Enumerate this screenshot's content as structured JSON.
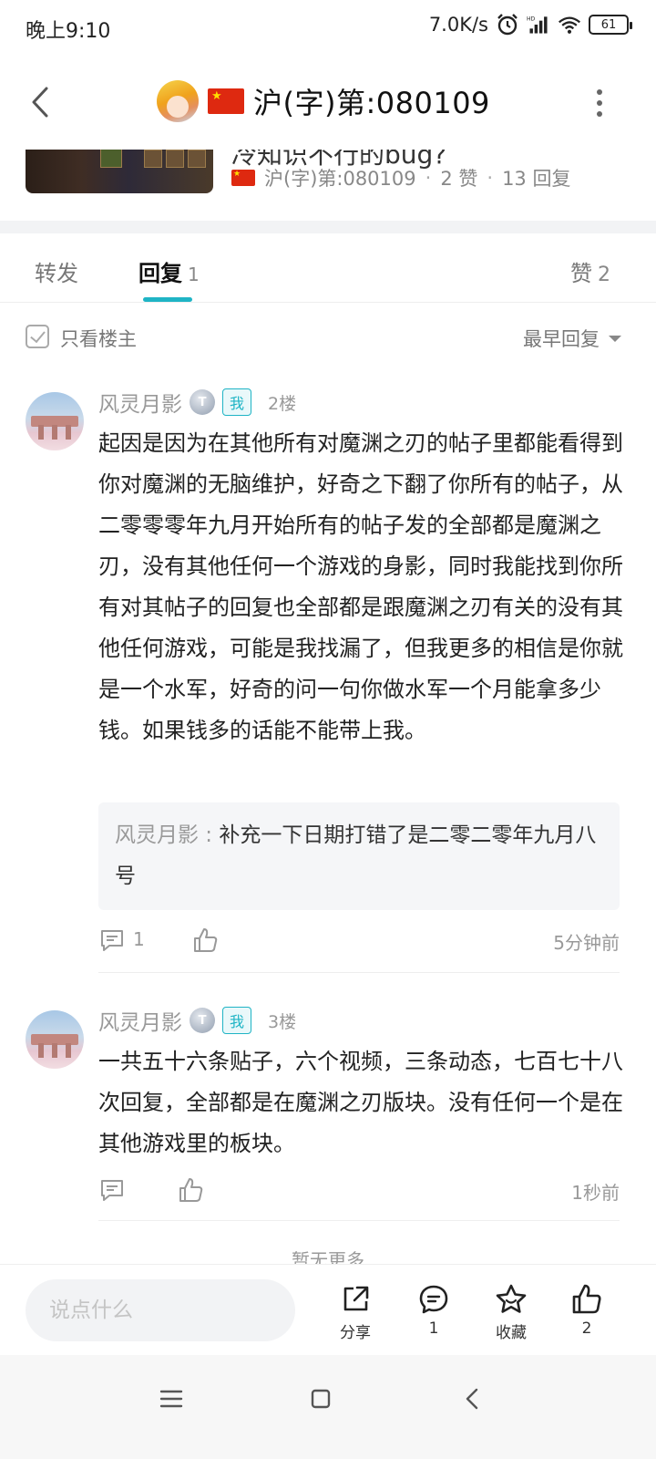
{
  "status_bar": {
    "time": "晚上9:10",
    "speed": "7.0K/s",
    "battery": "61"
  },
  "header": {
    "title": "沪(字)第:080109"
  },
  "post": {
    "cut_text": "冷知识不行的bug?",
    "author": "沪(字)第:080109",
    "likes": "2 赞",
    "replies": "13 回复"
  },
  "tabs": {
    "forward": "转发",
    "reply": "回复",
    "reply_count": "1",
    "like": "赞",
    "like_count": "2"
  },
  "filter": {
    "only_owner": "只看楼主",
    "sort": "最早回复"
  },
  "comments": [
    {
      "name": "风灵月影",
      "level": "T",
      "me": "我",
      "floor": "2楼",
      "body": "起因是因为在其他所有对魔渊之刃的帖子里都能看得到你对魔渊的无脑维护，好奇之下翻了你所有的帖子，从二零零零年九月开始所有的帖子发的全部都是魔渊之刃，没有其他任何一个游戏的身影，同时我能找到你所有对其帖子的回复也全部都是跟魔渊之刃有关的没有其他任何游戏，可能是我找漏了，但我更多的相信是你就是一个水军，好奇的问一句你做水军一个月能拿多少钱。如果钱多的话能不能带上我。",
      "quote_name": "风灵月影 : ",
      "quote_text": "补充一下日期打错了是二零二零年九月八号",
      "reply_count": "1",
      "time": "5分钟前"
    },
    {
      "name": "风灵月影",
      "level": "T",
      "me": "我",
      "floor": "3楼",
      "body": "一共五十六条贴子，六个视频，三条动态，七百七十八次回复，全部都是在魔渊之刃版块。没有任何一个是在其他游戏里的板块。",
      "time": "1秒前"
    }
  ],
  "no_more": "暂无更多",
  "bottom_bar": {
    "placeholder": "说点什么",
    "share": "分享",
    "comment_count": "1",
    "favorite": "收藏",
    "like_count": "2"
  },
  "colors": {
    "accent": "#1fb4c5",
    "text_primary": "#222222",
    "text_secondary": "#999999"
  },
  "icons": [
    "back-icon",
    "more-icon",
    "check-icon",
    "comment-icon",
    "thumb-up-icon",
    "share-icon",
    "star-icon",
    "menu-icon",
    "home-icon",
    "nav-back-icon"
  ]
}
